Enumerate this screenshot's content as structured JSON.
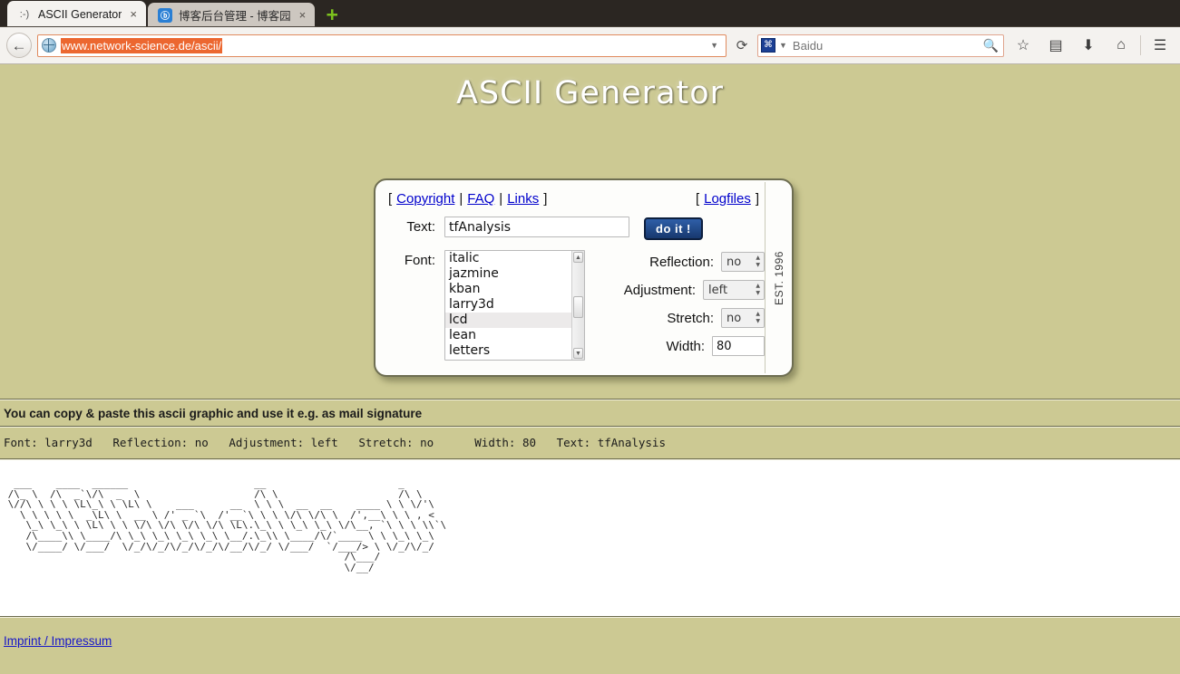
{
  "browser": {
    "tabs": [
      {
        "title": "ASCII Generator",
        "favicon": ":-)",
        "close": "×",
        "active": true
      },
      {
        "title": "博客后台管理 - 博客园",
        "favicon": "ⓑ",
        "close": "×",
        "active": false
      }
    ],
    "new_tab_label": "+",
    "back_icon": "←",
    "url": "www.network-science.de/ascii/",
    "url_dropdown_icon": "▼",
    "reload_icon": "⟳",
    "search": {
      "engine": "Baidu",
      "engine_icon": "⌘",
      "caret": "▼",
      "go_icon": "🔍"
    },
    "toolbar_icons": [
      {
        "name": "bookmark-star-icon",
        "glyph": "☆"
      },
      {
        "name": "reading-list-icon",
        "glyph": "▤"
      },
      {
        "name": "downloads-icon",
        "glyph": "⬇"
      },
      {
        "name": "home-icon",
        "glyph": "⌂"
      },
      {
        "name": "menu-hamburger-icon",
        "glyph": "☰"
      }
    ]
  },
  "page": {
    "title": "ASCII Generator",
    "est_text": "EST. 1996",
    "nav": {
      "open_bracket": "[",
      "close_bracket": "]",
      "pipe": "|",
      "copyright": "Copyright",
      "faq": "FAQ",
      "links": "Links",
      "logfiles": "Logfiles"
    },
    "form": {
      "text_label": "Text:",
      "text_value": "tfAnalysis",
      "text_placeholder": "",
      "submit_label": "do it !",
      "font_label": "Font:",
      "font_options": [
        "italic",
        "jazmine",
        "kban",
        "larry3d",
        "lcd",
        "lean",
        "letters"
      ],
      "font_selected": "lcd",
      "scroll_up_icon": "▲",
      "scroll_down_icon": "▼",
      "reflection_label": "Reflection:",
      "reflection_value": "no",
      "adjustment_label": "Adjustment:",
      "adjustment_value": "left",
      "stretch_label": "Stretch:",
      "stretch_value": "no",
      "width_label": "Width:",
      "width_value": "80",
      "spinner_up": "▲",
      "spinner_down": "▼"
    },
    "result": {
      "notice": "You can copy & paste this ascii graphic and use it e.g. as mail signature",
      "params": "Font: larry3d   Reflection: no   Adjustment: left   Stretch: no      Width: 80   Text: tfAnalysis",
      "ascii_art": "  ___    ____  ______                     __                      _\n /\\_ \\  /\\  _`\\/\\  _  \\                   /\\ \\                    /\\ \\\n \\//\\ \\ \\ \\ \\L\\_\\ \\ \\L\\ \\    ___      __  \\ \\ \\  __  __    ____ \\ \\ \\/'\\\n   \\ \\ \\ \\ \\  _\\L\\ \\  __ \\ /' _ `\\  /'__`\\ \\ \\ \\/\\ \\/\\ \\  /',__\\ \\ \\ , <\n    \\_\\ \\_\\ \\ \\L\\ \\ \\ \\/\\ \\/\\ \\/\\ \\/\\ \\L\\.\\_\\ \\ \\_\\ \\_\\ \\/\\__, `\\ \\ \\ \\\\`\\\n    /\\____\\\\ \\____/\\ \\_\\ \\_\\ \\_\\ \\_\\ \\__/.\\_\\\\ \\____/\\/`____ \\ \\ \\_\\ \\_\\\n    \\/____/ \\/___/  \\/_/\\/_/\\/_/\\/_/\\/__/\\/_/ \\/___/  `/___/> \\ \\/_/\\/_/\n                                                         /\\___/\n                                                         \\/__/"
    },
    "footer": {
      "imprint": "Imprint / Impressum"
    }
  },
  "colors": {
    "page_background": "#ccc993",
    "url_highlight": "#ec6730",
    "link": "#0000cc",
    "button_blue": "#17386e",
    "rule_dark": "#6b6b4e"
  }
}
